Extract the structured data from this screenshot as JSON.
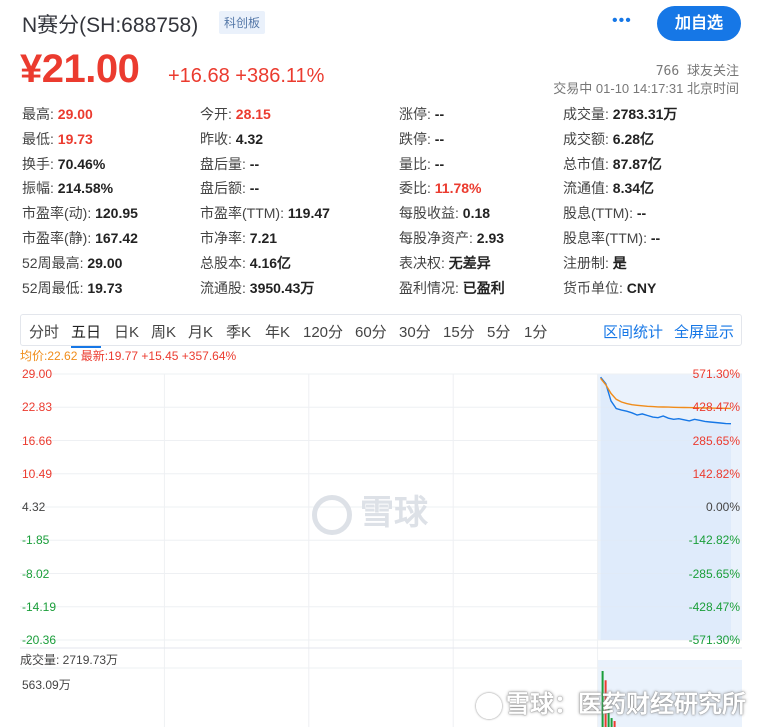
{
  "header": {
    "stock_name": "N赛分(SH:688758)",
    "badge": "科创板",
    "more_icon": "more-dots-icon",
    "add_button": "加自选"
  },
  "price": {
    "current": "¥21.00",
    "change": "+16.68  +386.11%",
    "followers": "766 球友关注",
    "status": "交易中 01-10 14:17:31 北京时间"
  },
  "quote_rows": [
    [
      {
        "label": "最高:",
        "value": "29.00",
        "color": "red"
      },
      {
        "label": "今开:",
        "value": "28.15",
        "color": "red"
      },
      {
        "label": "涨停:",
        "value": "--"
      },
      {
        "label": "成交量:",
        "value": "2783.31万"
      }
    ],
    [
      {
        "label": "最低:",
        "value": "19.73",
        "color": "red"
      },
      {
        "label": "昨收:",
        "value": "4.32"
      },
      {
        "label": "跌停:",
        "value": "--"
      },
      {
        "label": "成交额:",
        "value": "6.28亿"
      }
    ],
    [
      {
        "label": "换手:",
        "value": "70.46%"
      },
      {
        "label": "盘后量:",
        "value": "--"
      },
      {
        "label": "量比:",
        "value": "--"
      },
      {
        "label": "总市值:",
        "value": "87.87亿"
      }
    ],
    [
      {
        "label": "振幅:",
        "value": "214.58%"
      },
      {
        "label": "盘后额:",
        "value": "--"
      },
      {
        "label": "委比:",
        "value": "11.78%",
        "color": "red"
      },
      {
        "label": "流通值:",
        "value": "8.34亿"
      }
    ],
    [
      {
        "label": "市盈率(动):",
        "value": "120.95"
      },
      {
        "label": "市盈率(TTM):",
        "value": "119.47"
      },
      {
        "label": "每股收益:",
        "value": "0.18"
      },
      {
        "label": "股息(TTM):",
        "value": "--"
      }
    ],
    [
      {
        "label": "市盈率(静):",
        "value": "167.42"
      },
      {
        "label": "市净率:",
        "value": "7.21"
      },
      {
        "label": "每股净资产:",
        "value": "2.93"
      },
      {
        "label": "股息率(TTM):",
        "value": "--"
      }
    ],
    [
      {
        "label": "52周最高:",
        "value": "29.00"
      },
      {
        "label": "总股本:",
        "value": "4.16亿"
      },
      {
        "label": "表决权:",
        "value": "无差异"
      },
      {
        "label": "注册制:",
        "value": "是"
      }
    ],
    [
      {
        "label": "52周最低:",
        "value": "19.73"
      },
      {
        "label": "流通股:",
        "value": "3950.43万"
      },
      {
        "label": "盈利情况:",
        "value": "已盈利"
      },
      {
        "label": "货币单位:",
        "value": "CNY"
      }
    ]
  ],
  "period_tabs": [
    "分时",
    "五日",
    "日K",
    "周K",
    "月K",
    "季K",
    "年K",
    "120分",
    "60分",
    "30分",
    "15分",
    "5分",
    "1分"
  ],
  "active_tab": "五日",
  "tools": [
    "区间统计",
    "全屏显示"
  ],
  "chart_legend": {
    "avg": "均价:22.62",
    "latest": "最新:19.77 +15.45 +357.64%"
  },
  "chart_data": {
    "type": "line",
    "y_left_ticks": [
      "29.00",
      "22.83",
      "16.66",
      "10.49",
      "4.32",
      "-1.85",
      "-8.02",
      "-14.19",
      "-20.36"
    ],
    "y_right_ticks": [
      "571.30%",
      "428.47%",
      "285.65%",
      "142.82%",
      "0.00%",
      "-142.82%",
      "-285.65%",
      "-428.47%",
      "-571.30%"
    ],
    "ylim": [
      -20.36,
      29.0
    ],
    "days": 5,
    "active_day_index": 4,
    "series": [
      {
        "name": "最新",
        "color": "#1677e6",
        "values": [
          28.4,
          27.2,
          24.0,
          22.6,
          22.3,
          22.1,
          21.8,
          21.4,
          21.6,
          21.3,
          21.0,
          20.9,
          21.2,
          20.8,
          20.6,
          20.7,
          20.5,
          20.3,
          20.6,
          20.4,
          20.2,
          20.1,
          20.0,
          19.9,
          19.8,
          19.77
        ]
      },
      {
        "name": "均价",
        "color": "#f08c1a",
        "values": [
          28.2,
          27.0,
          25.4,
          24.3,
          23.8,
          23.5,
          23.3,
          23.2,
          23.1,
          23.0,
          22.95,
          22.9,
          22.88,
          22.85,
          22.82,
          22.8,
          22.78,
          22.76,
          22.74,
          22.72,
          22.7,
          22.68,
          22.66,
          22.65,
          22.63,
          22.62
        ]
      }
    ],
    "volume": {
      "label": "成交量: 2719.73万",
      "max_label": "563.09万",
      "bars": [
        {
          "value": 563.09,
          "color": "green"
        },
        {
          "value": 470.0,
          "color": "red"
        },
        {
          "value": 210.0,
          "color": "green"
        },
        {
          "value": 90.0,
          "color": "green"
        },
        {
          "value": 60.0,
          "color": "red"
        }
      ]
    }
  },
  "watermark": "雪球",
  "source_watermark": "雪球：医药财经研究所"
}
